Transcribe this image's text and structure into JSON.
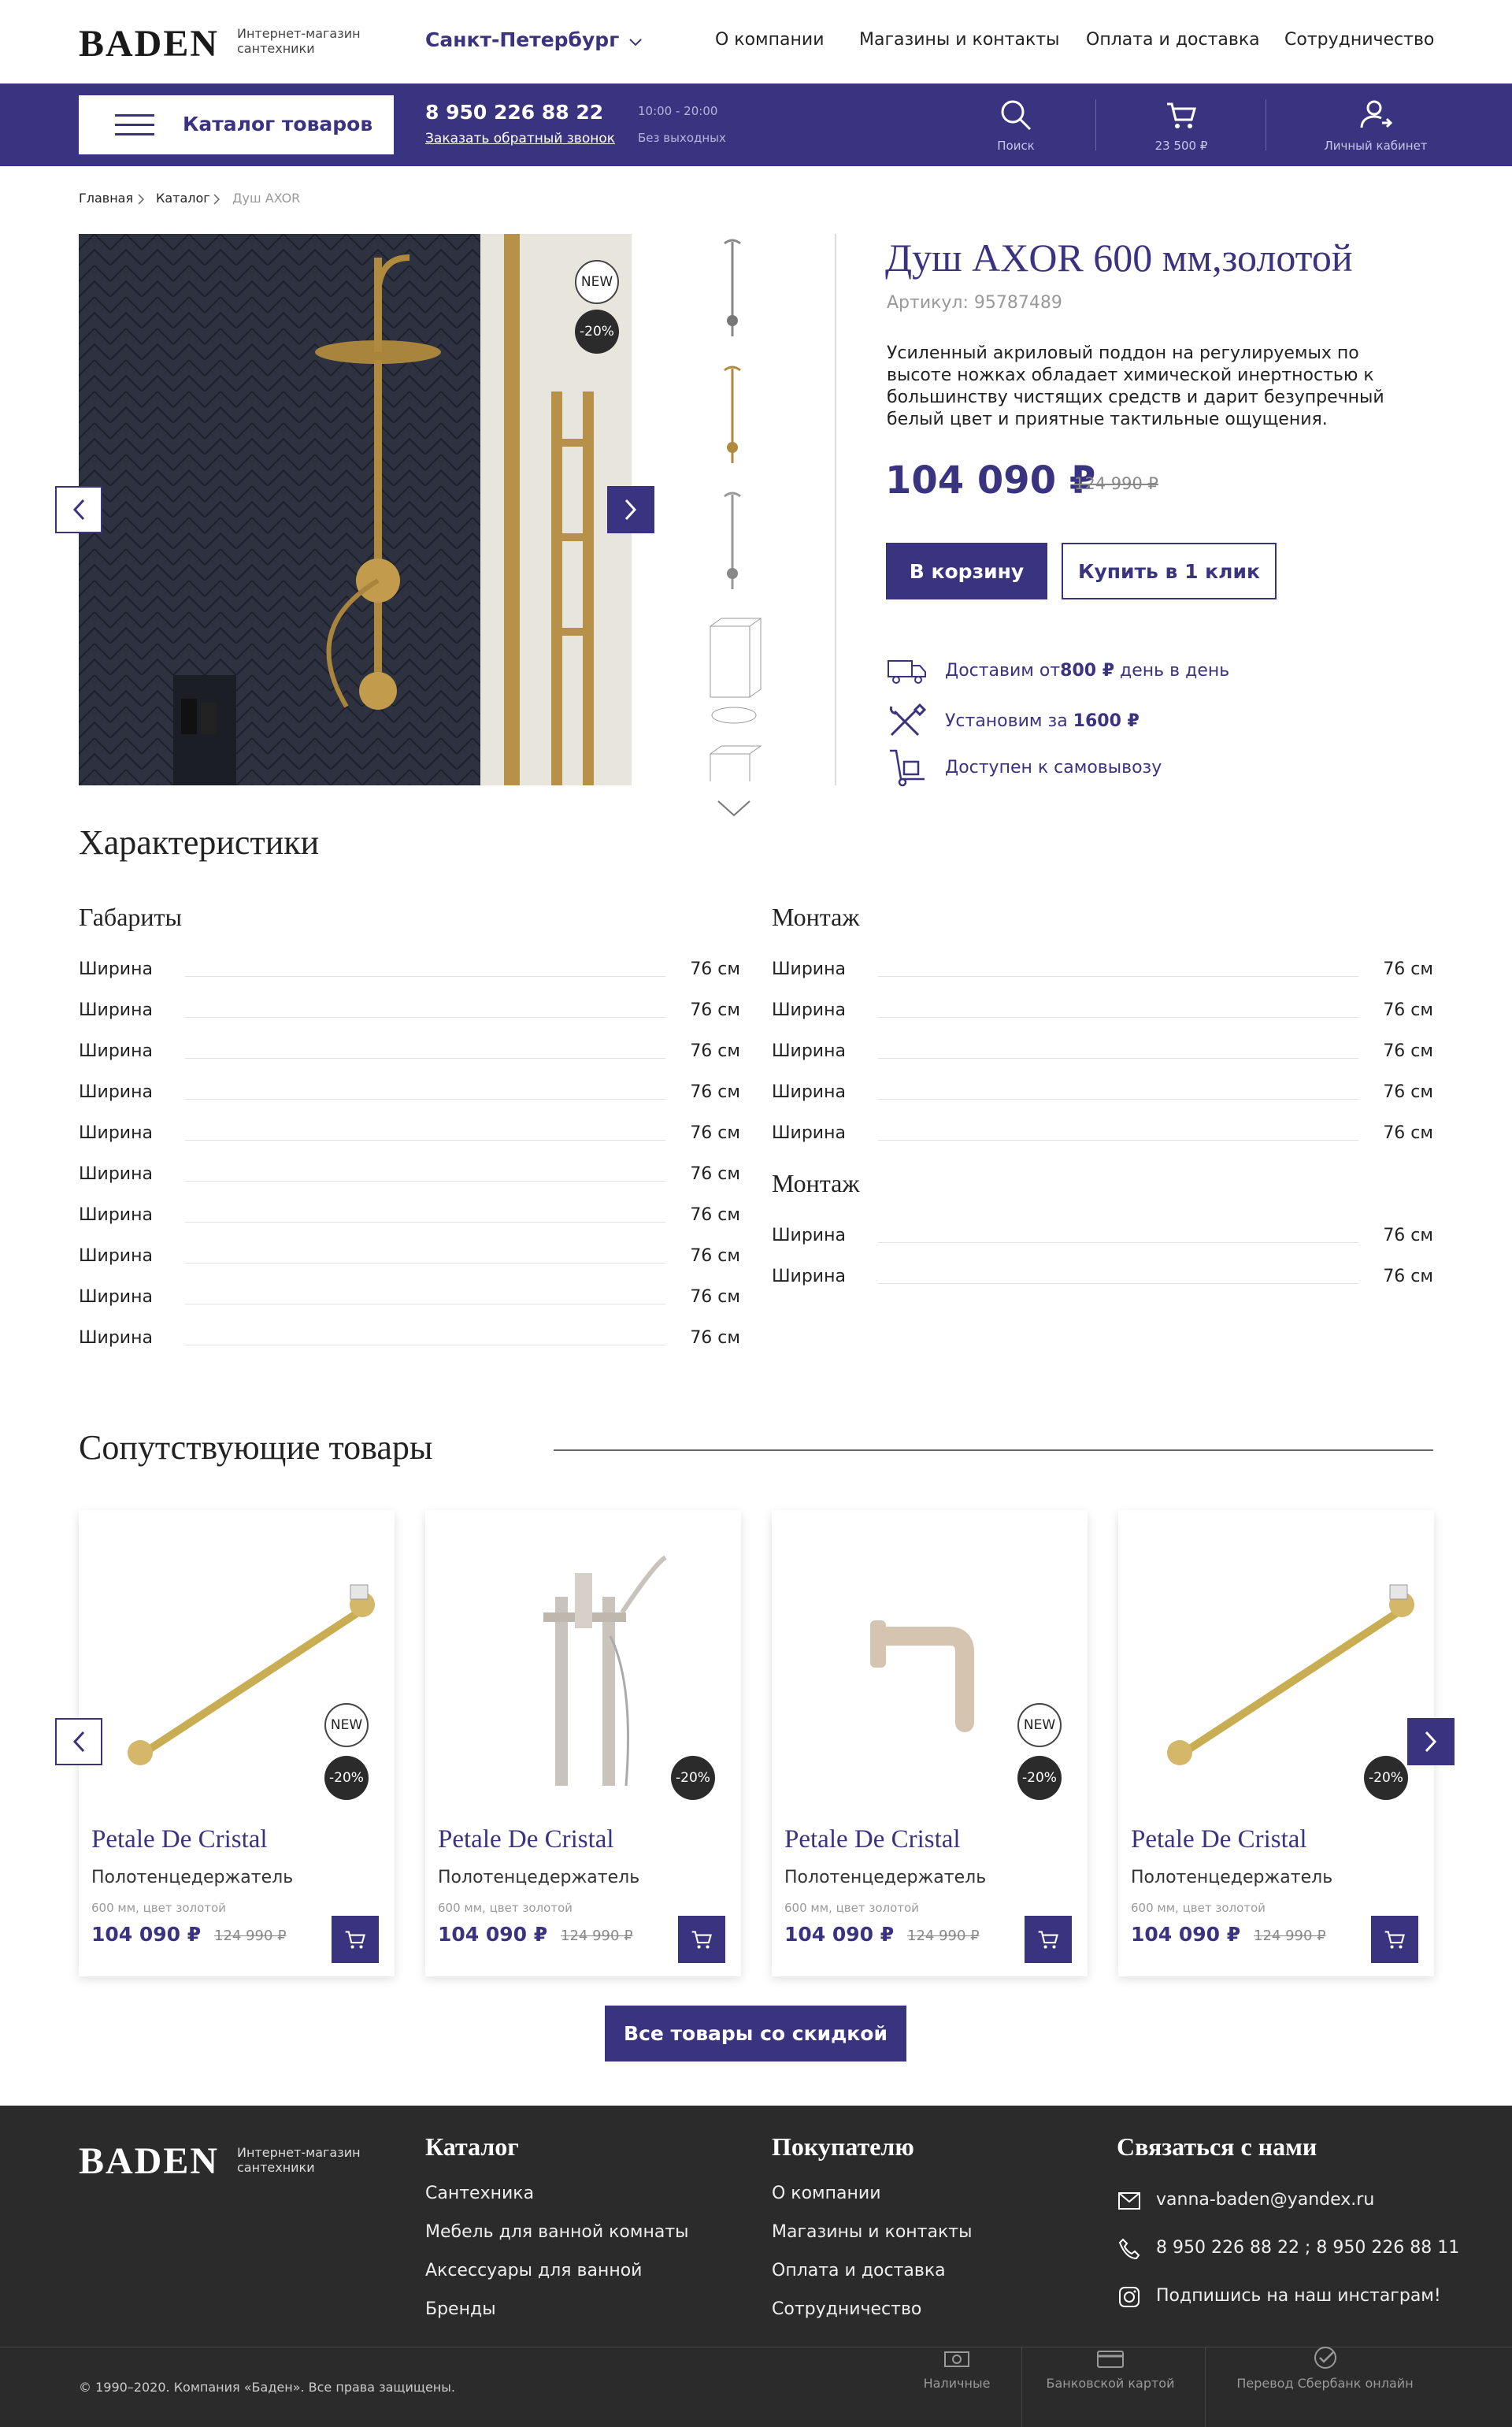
{
  "header": {
    "logo": "BADEN",
    "logo_sub1": "Интернет-магазин",
    "logo_sub2": "сантехники",
    "city": "Санкт-Петербург",
    "nav": [
      "О компании",
      "Магазины и контакты",
      "Оплата и доставка",
      "Сотрудничество"
    ]
  },
  "bar": {
    "catalog": "Каталог товаров",
    "phone": "8 950 226 88 22",
    "callback": "Заказать обратный звонок",
    "hours": "10:00 - 20:00",
    "days": "Без выходных",
    "search": "Поиск",
    "cart": "23 500 ₽",
    "account": "Личный кабинет"
  },
  "breadcrumb": [
    "Главная",
    "Каталог",
    "Душ AXOR"
  ],
  "product": {
    "badge_new": "NEW",
    "badge_disc": "-20%",
    "title": "Душ AXOR 600 мм,золотой",
    "article": "Артикул: 95787489",
    "desc": "Усиленный акриловый поддон на регулируемых по высоте ножках обладает химической инертностью к большинству чистящих средств и дарит безупречный белый цвет и приятные тактильные ощущения.",
    "price": "104 090 ₽",
    "old_price": "124 990 ₽",
    "btn_cart": "В корзину",
    "btn_one": "Купить в 1 клик",
    "feat1_a": "Доставим от ",
    "feat1_b": "800 ₽",
    "feat1_c": " день в день",
    "feat2_a": "Установим за ",
    "feat2_b": "1600 ₽",
    "feat3": "Доступен к самовывозу"
  },
  "specs": {
    "title": "Характеристики",
    "g1": "Габариты",
    "g2": "Монтаж",
    "g3": "Монтаж",
    "key": "Ширина",
    "val": "76 см"
  },
  "related": {
    "title": "Сопутствующие товары",
    "cards": [
      {
        "title": "Petale De Cristal",
        "sub": "Полотенцедержатель",
        "meta": "600 мм, цвет золотой",
        "price": "104 090 ₽",
        "old": "124 990 ₽",
        "new": "NEW",
        "disc": "-20%"
      },
      {
        "title": "Petale De Cristal",
        "sub": "Полотенцедержатель",
        "meta": "600 мм, цвет золотой",
        "price": "104 090 ₽",
        "old": "124 990 ₽",
        "new": "",
        "disc": "-20%"
      },
      {
        "title": "Petale De Cristal",
        "sub": "Полотенцедержатель",
        "meta": "600 мм, цвет золотой",
        "price": "104 090 ₽",
        "old": "124 990 ₽",
        "new": "NEW",
        "disc": "-20%"
      },
      {
        "title": "Petale De Cristal",
        "sub": "Полотенцедержатель",
        "meta": "600 мм, цвет золотой",
        "price": "104 090 ₽",
        "old": "124 990 ₽",
        "new": "",
        "disc": "-20%"
      }
    ],
    "all_btn": "Все товары со скидкой"
  },
  "footer": {
    "catalog_h": "Каталог",
    "catalog": [
      "Сантехника",
      "Мебель для ванной комнаты",
      "Аксессуары для ванной",
      "Бренды"
    ],
    "buyer_h": "Покупателю",
    "buyer": [
      "О компании",
      "Магазины и контакты",
      "Оплата и доставка",
      "Сотрудничество"
    ],
    "contact_h": "Связаться с нами",
    "email": "vanna-baden@yandex.ru",
    "phones": "8 950 226 88 22 ; 8 950 226 88 11",
    "insta": "Подпишись на наш инстаграм!",
    "copyright": "© 1990–2020. Компания «Баден». Все права защищены.",
    "pay": [
      "Наличные",
      "Банковской картой",
      "Перевод Сбербанк онлайн"
    ]
  },
  "colors": {
    "accent": "#3a3480",
    "footer": "#2b2b2b"
  }
}
